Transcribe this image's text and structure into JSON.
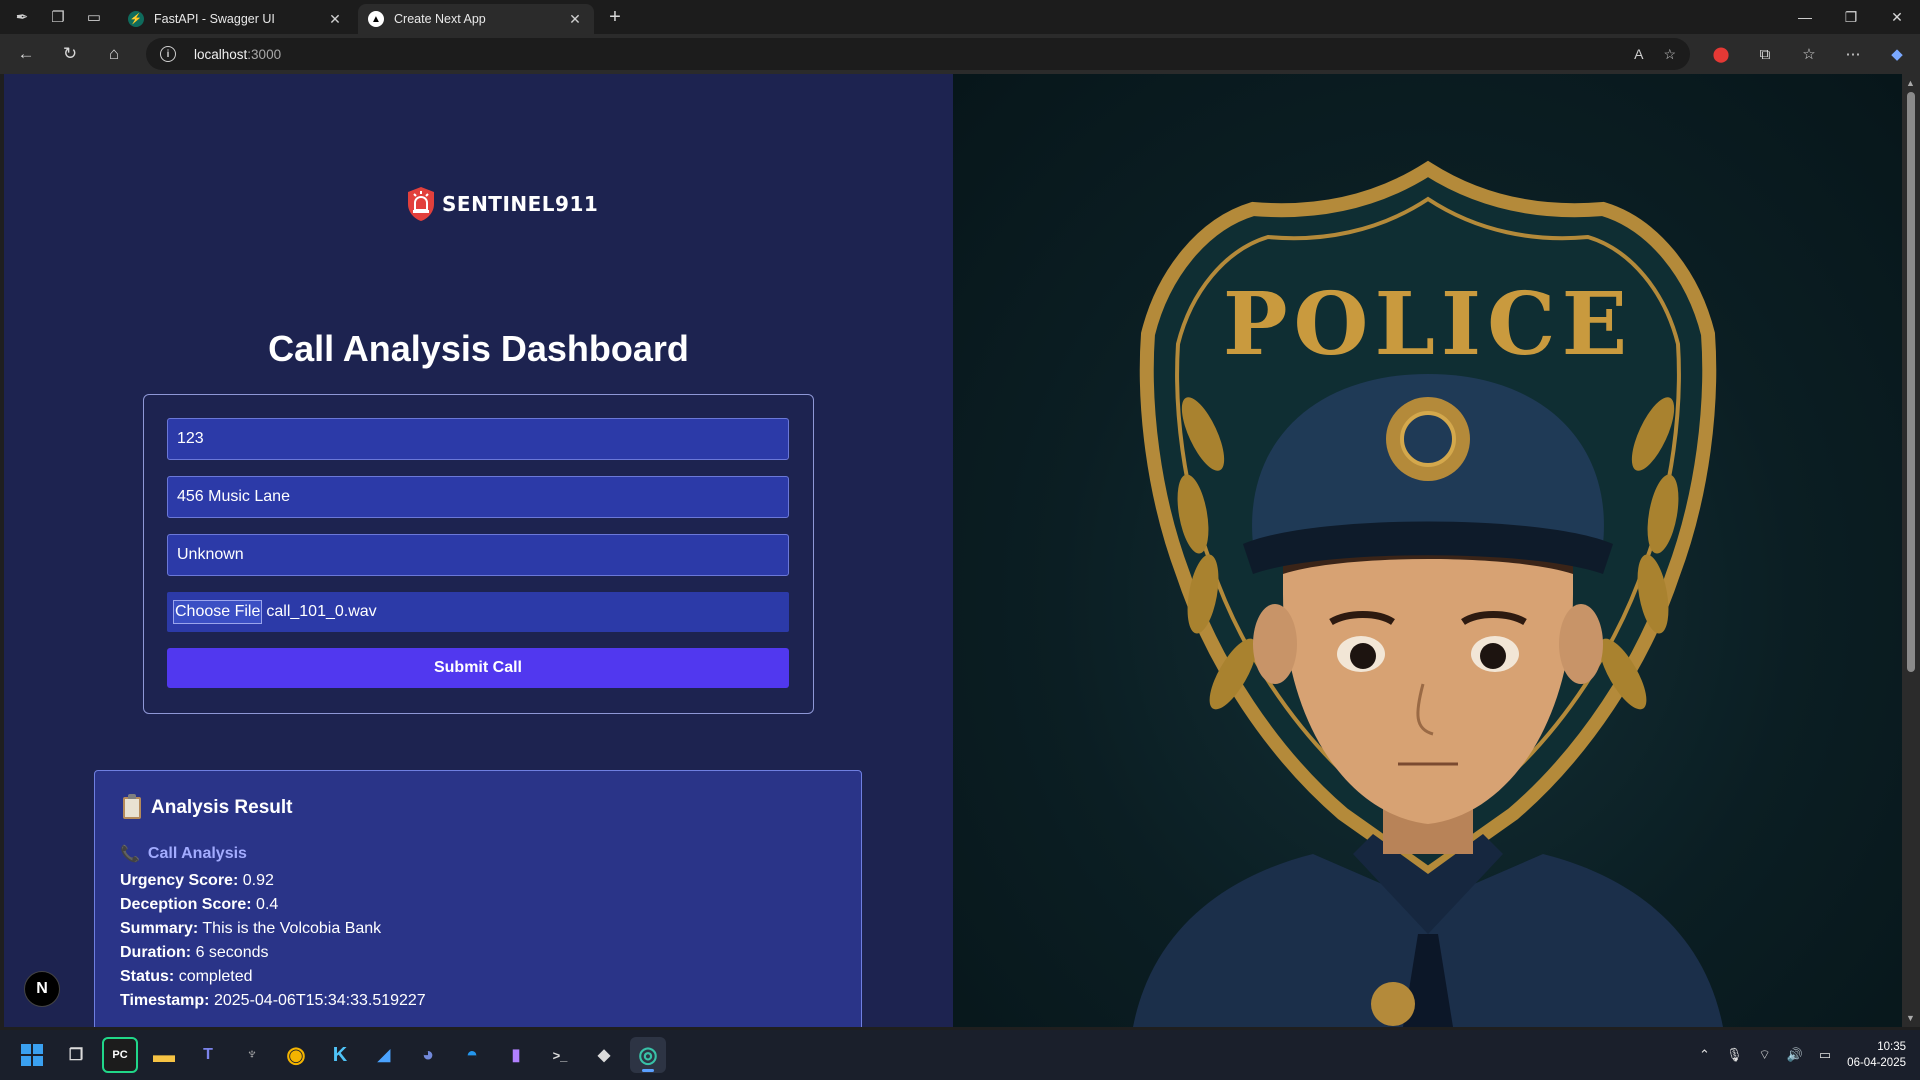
{
  "browser": {
    "tabs": [
      {
        "title": "FastAPI - Swagger UI",
        "active": false
      },
      {
        "title": "Create Next App",
        "active": true
      }
    ],
    "url_host": "localhost",
    "url_port": ":3000"
  },
  "page": {
    "logo_text": "SENTINEL911",
    "title": "Call Analysis Dashboard",
    "form": {
      "field1_value": "123",
      "field2_value": "456 Music Lane",
      "field3_value": "Unknown",
      "file_button_label": "Choose File",
      "file_name": "call_101_0.wav",
      "submit_label": "Submit Call"
    },
    "result": {
      "title": "Analysis Result",
      "section_title": "Call Analysis",
      "lines": [
        {
          "label": "Urgency Score:",
          "value": "0.92"
        },
        {
          "label": "Deception Score:",
          "value": "0.4"
        },
        {
          "label": "Summary:",
          "value": "This is the Volcobia Bank"
        },
        {
          "label": "Duration:",
          "value": "6 seconds"
        },
        {
          "label": "Status:",
          "value": "completed"
        },
        {
          "label": "Timestamp:",
          "value": "2025-04-06T15:34:33.519227"
        }
      ]
    },
    "hero_badge_text": "POLICE",
    "next_badge": "N"
  },
  "taskbar": {
    "time": "10:35",
    "date": "06-04-2025",
    "apps": [
      "windows-start",
      "task-view",
      "pycharm",
      "file-explorer",
      "teams",
      "alienware",
      "chrome",
      "k-app",
      "paint",
      "discord",
      "docker",
      "visual-studio",
      "terminal",
      "github-desktop",
      "edge"
    ]
  },
  "colors": {
    "left_bg": "#1d2350",
    "field_bg": "#2c3aa8",
    "submit_bg": "#5138ef",
    "result_bg": "#2a3488",
    "accent_label": "#a3acff"
  }
}
